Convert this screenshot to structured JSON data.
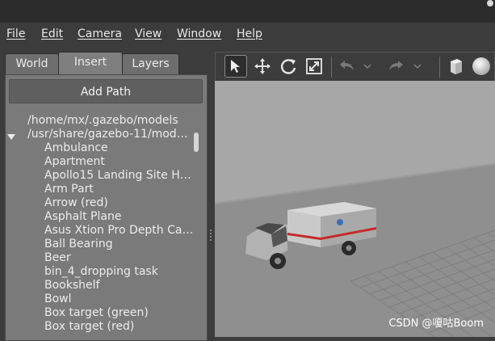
{
  "menu": {
    "items": [
      {
        "label": "File"
      },
      {
        "label": "Edit"
      },
      {
        "label": "Camera"
      },
      {
        "label": "View"
      },
      {
        "label": "Window"
      },
      {
        "label": "Help"
      }
    ]
  },
  "left_panel": {
    "tabs": [
      {
        "label": "World",
        "active": false
      },
      {
        "label": "Insert",
        "active": true
      },
      {
        "label": "Layers",
        "active": false
      }
    ],
    "add_path_label": "Add Path",
    "paths": [
      {
        "label": "/home/mx/.gazebo/models",
        "expanded": false
      },
      {
        "label": "/usr/share/gazebo-11/mod…",
        "expanded": true
      }
    ],
    "models": [
      "Ambulance",
      "Apartment",
      "Apollo15 Landing Site H…",
      "Arm Part",
      "Arrow (red)",
      "Asphalt Plane",
      "Asus Xtion Pro Depth Ca…",
      "Ball Bearing",
      "Beer",
      "bin_4_dropping task",
      "Bookshelf",
      "Bowl",
      "Box target (green)",
      "Box target (red)"
    ]
  },
  "toolbar": {
    "tools": [
      {
        "icon": "select-arrow-icon",
        "selected": true
      },
      {
        "icon": "translate-icon",
        "selected": false
      },
      {
        "icon": "rotate-icon",
        "selected": false
      },
      {
        "icon": "scale-icon",
        "selected": false
      },
      {
        "icon": "undo-icon",
        "selected": false
      },
      {
        "icon": "redo-icon",
        "selected": false
      },
      {
        "icon": "box-shape-icon",
        "selected": false
      },
      {
        "icon": "sphere-shape-icon",
        "selected": false
      }
    ]
  },
  "viewport": {
    "model": "ambulance",
    "colors": {
      "sky": "#a7a7a7",
      "ground": "#8e8e8e",
      "grid": "#7d7d7d",
      "ambulance_stripe": "#c42a2a"
    }
  },
  "watermark": "CSDN @嗄咕Boom"
}
